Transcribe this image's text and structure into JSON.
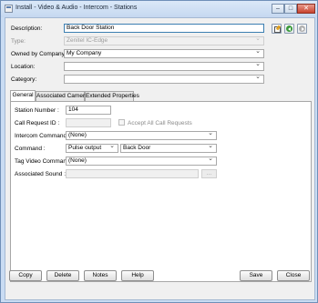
{
  "window": {
    "title": "Install - Video & Audio - Intercom - Stations",
    "minimize_glyph": "–",
    "maximize_glyph": "□",
    "close_glyph": "✕"
  },
  "form": {
    "description_label": "Description:",
    "description_value": "Back Door Station",
    "type_label": "Type:",
    "type_value": "Zenitel IC-Edge",
    "owned_by_label": "Owned by Company:",
    "owned_by_value": "My Company",
    "location_label": "Location:",
    "location_value": "",
    "category_label": "Category:",
    "category_value": ""
  },
  "toolbar_icons": [
    "notes-edit-icon",
    "back-arrow-icon",
    "forward-arrow-icon"
  ],
  "tabs": [
    {
      "label": "General"
    },
    {
      "label": "Associated Cameras"
    },
    {
      "label": "Extended Properties"
    }
  ],
  "general": {
    "station_number_label": "Station Number :",
    "station_number_value": "104",
    "call_request_id_label": "Call Request ID :",
    "call_request_id_value": "",
    "accept_all_label": "Accept All Call Requests",
    "accept_all_checked": false,
    "intercom_command_label": "Intercom Command :",
    "intercom_command_value": "(None)",
    "command_label": "Command :",
    "command_value": "Pulse output",
    "command_target_value": "Back Door",
    "tag_video_label": "Tag Video Command :",
    "tag_video_value": "(None)",
    "associated_sound_label": "Associated Sound :",
    "associated_sound_value": "",
    "browse_label": "..."
  },
  "buttons": {
    "copy": "Copy",
    "delete": "Delete",
    "notes": "Notes",
    "help": "Help",
    "save": "Save",
    "close": "Close"
  }
}
